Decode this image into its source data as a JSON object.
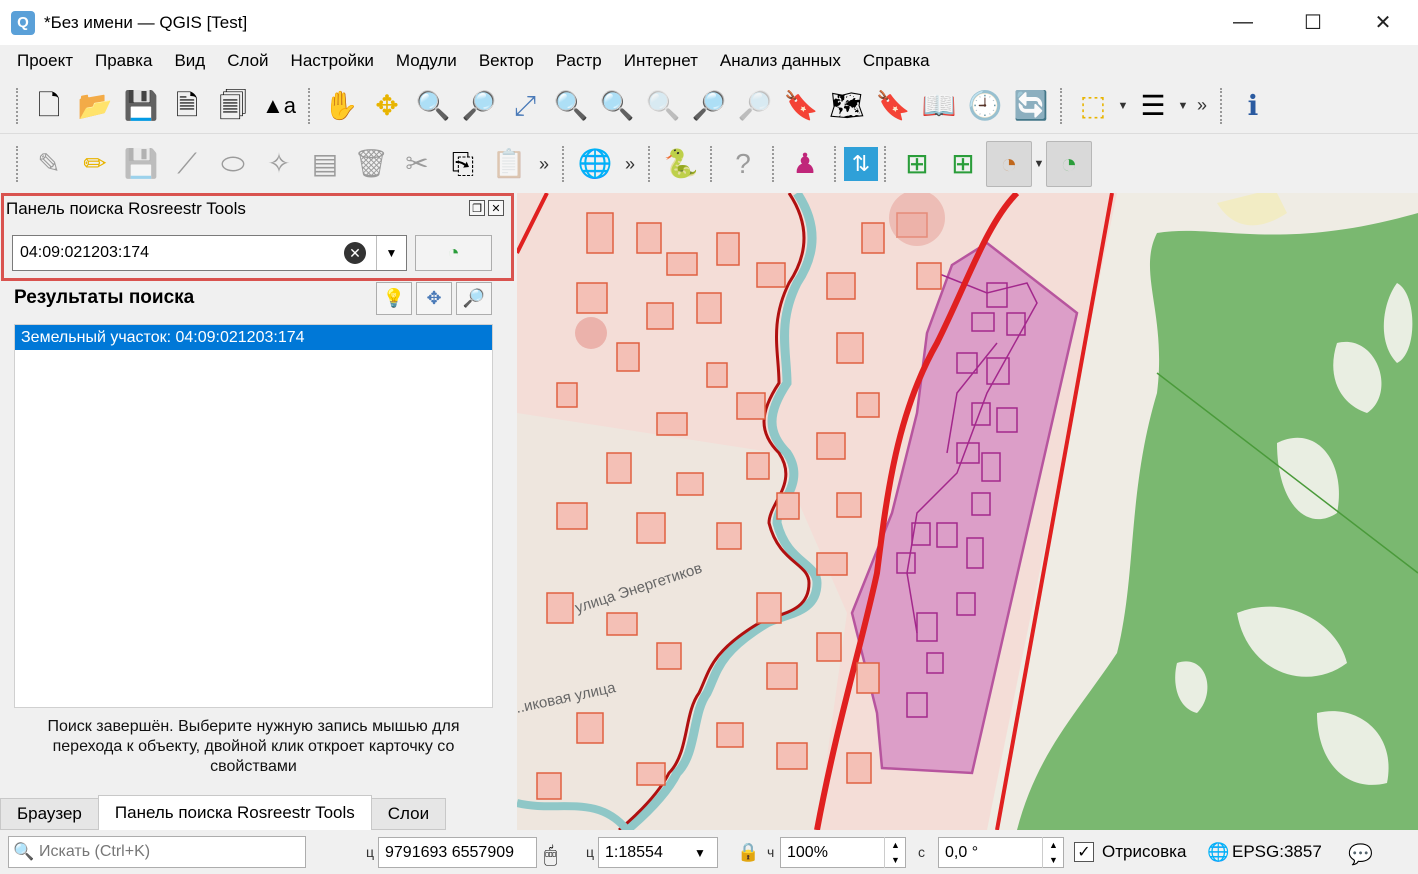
{
  "window": {
    "title": "*Без имени — QGIS [Test]",
    "app_icon_letter": "Q",
    "minimize": "—",
    "maximize": "☐",
    "close": "✕"
  },
  "menu": [
    "Проект",
    "Правка",
    "Вид",
    "Слой",
    "Настройки",
    "Модули",
    "Вектор",
    "Растр",
    "Интернет",
    "Анализ данных",
    "Справка"
  ],
  "toolbar1": {
    "icons": [
      "new-project-icon",
      "open-project-icon",
      "save-project-icon",
      "new-print-layout-icon",
      "layout-manager-icon",
      "style-manager-icon",
      "pan-icon",
      "pan-to-selection-icon",
      "zoom-in-icon",
      "zoom-out-icon",
      "zoom-full-icon",
      "zoom-to-selection-icon",
      "zoom-to-layer-icon",
      "zoom-native-icon",
      "zoom-last-icon",
      "zoom-next-icon",
      "new-bookmark-icon",
      "show-bookmarks-icon",
      "new-map-view-icon",
      "temporal-controller-icon",
      "refresh-icon",
      "select-features-icon",
      "open-attribute-table-icon",
      "identify-icon"
    ],
    "more": "»"
  },
  "toolbar2": {
    "more": "»"
  },
  "dock": {
    "title": "Панель поиска Rosreestr Tools",
    "search_value": "04:09:021203:174",
    "results_title": "Результаты поиска",
    "results": [
      "Земельный участок: 04:09:021203:174"
    ],
    "status_message": "Поиск завершён. Выберите нужную запись мышью для перехода к объекту, двойной клик откроет карточку со свойствами"
  },
  "tabs": [
    "Браузер",
    "Панель поиска Rosreestr Tools",
    "Слои"
  ],
  "map": {
    "labels": [
      "улица Энергетиков",
      "..иковая улица"
    ]
  },
  "status": {
    "locator_placeholder": "Искать (Ctrl+K)",
    "coord_label": "ц",
    "coordinates": "9791693  6557909",
    "scale_label": "ц",
    "scale": "1:18554",
    "magnifier_label": "ч",
    "magnifier": "100%",
    "rotation_label": "с",
    "rotation": "0,0 °",
    "render_label": "Отрисовка",
    "render_checked": "✓",
    "crs": "EPSG:3857"
  },
  "colors": {
    "accent": "#0078d7",
    "highlight_frame": "#d9534f",
    "parcel": "#c86bb3",
    "forest": "#74b36b"
  }
}
